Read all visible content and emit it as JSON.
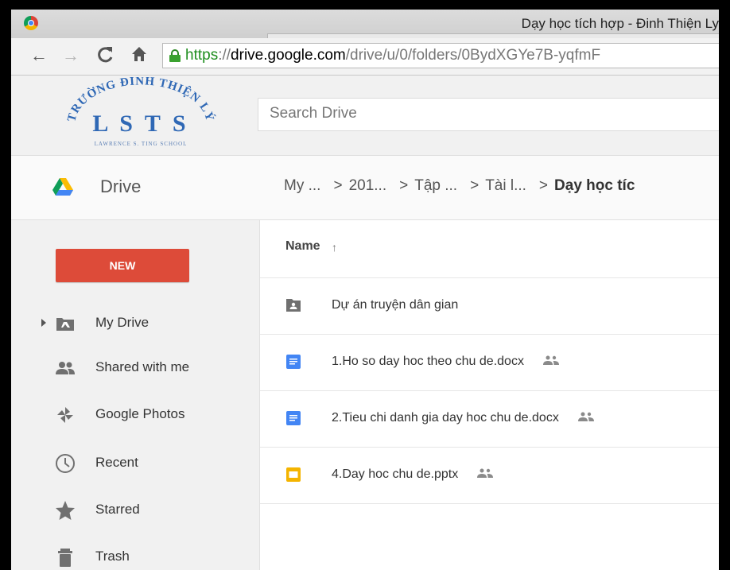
{
  "window": {
    "title": "Dạy học tích hợp - Đinh Thiện Ly"
  },
  "browser": {
    "url_scheme": "https",
    "url_scheme_sep": "://",
    "url_domain": "drive.google.com",
    "url_path": "/drive/u/0/folders/0BydXGYe7B-yqfmF"
  },
  "logo": {
    "top_text": "TRƯỜNG ĐINH THIỆN LÝ",
    "letters": "L S T S",
    "bottom_text": "LAWRENCE S. TING SCHOOL"
  },
  "search": {
    "placeholder": "Search Drive"
  },
  "drive": {
    "label": "Drive"
  },
  "breadcrumb": {
    "items": [
      "My ...",
      "201...",
      "Tập ...",
      "Tài l...",
      "Dạy học tíc"
    ],
    "separator": ">"
  },
  "sidebar": {
    "new_label": "NEW",
    "items": [
      {
        "label": "My Drive",
        "icon": "my-drive-icon"
      },
      {
        "label": "Shared with me",
        "icon": "people-icon"
      },
      {
        "label": "Google Photos",
        "icon": "pinwheel-icon"
      },
      {
        "label": "Recent",
        "icon": "clock-icon"
      },
      {
        "label": "Starred",
        "icon": "star-icon"
      },
      {
        "label": "Trash",
        "icon": "trash-icon"
      }
    ]
  },
  "list": {
    "column_name": "Name",
    "sort_arrow": "↑",
    "files": [
      {
        "name": "Dự án truyện dân gian",
        "type": "shared-folder",
        "shared": false
      },
      {
        "name": "1.Ho so day hoc theo chu de.docx",
        "type": "doc",
        "shared": true
      },
      {
        "name": "2.Tieu chi danh gia day hoc chu de.docx",
        "type": "doc",
        "shared": true
      },
      {
        "name": "4.Day hoc chu de.pptx",
        "type": "slides",
        "shared": true
      }
    ]
  },
  "colors": {
    "new_button": "#dd4b39",
    "doc_blue": "#4285f4",
    "slides_yellow": "#f4b400",
    "secure_green": "#1e8e1e"
  }
}
